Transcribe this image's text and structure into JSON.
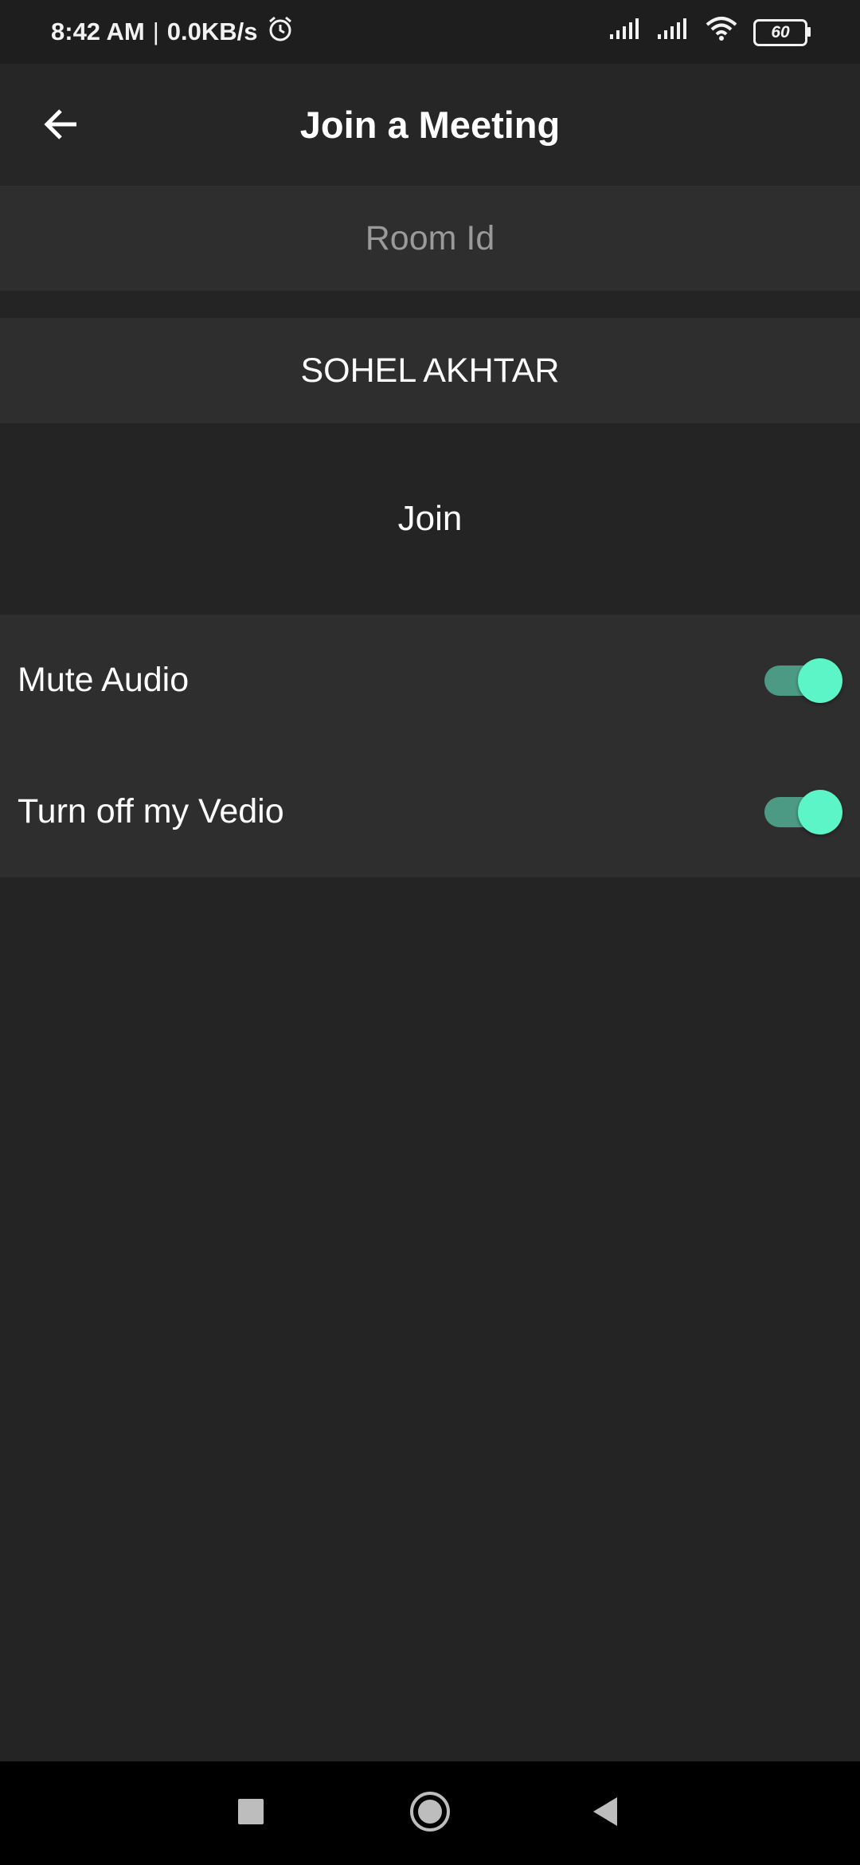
{
  "status_bar": {
    "time": "8:42 AM",
    "separator": "|",
    "net_speed": "0.0KB/s",
    "battery": "60",
    "icons": [
      "alarm-icon",
      "signal-icon",
      "signal-icon",
      "wifi-icon",
      "battery-icon"
    ]
  },
  "app_bar": {
    "back_icon": "arrow-left-icon",
    "title": "Join a Meeting"
  },
  "form": {
    "room_id": {
      "value": "",
      "placeholder": "Room Id"
    },
    "name": {
      "value": "SOHEL AKHTAR",
      "placeholder": ""
    },
    "join_label": "Join"
  },
  "settings": [
    {
      "label": "Mute Audio",
      "enabled": true
    },
    {
      "label": "Turn off my Vedio",
      "enabled": true
    }
  ],
  "colors": {
    "background": "#242424",
    "field_background": "#2e2e2e",
    "toggle_thumb": "#5cf5c8",
    "toggle_track": "#4c9a83"
  },
  "nav_bar": {
    "icons": [
      "recents-square-icon",
      "home-circle-icon",
      "back-triangle-icon"
    ]
  }
}
